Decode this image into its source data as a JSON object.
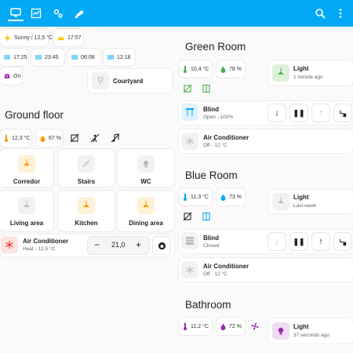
{
  "colors": {
    "header": "#03a9f4",
    "amber": "#ffc107",
    "orange": "#ff9800",
    "red": "#e53935",
    "purple": "#9c27b0",
    "green": "#4caf50",
    "blue": "#03a9f4"
  },
  "header": {
    "tabs": [
      "monitor-icon",
      "chart-icon",
      "settings-icon",
      "camera-icon"
    ],
    "actions": [
      "search-icon",
      "dots-menu-icon"
    ]
  },
  "left": {
    "weather": "Sunny / 12,5 °C",
    "clock": "17:57",
    "schedule": [
      "17:25",
      "23:45",
      "06:08",
      "12:18"
    ],
    "alarm_state": "On",
    "courtyard": "Courtyard",
    "ground_floor": {
      "title": "Ground floor",
      "temperature": "12,3 °C",
      "humidity": "67 %",
      "rooms": [
        "Corredor",
        "Stairs",
        "WC",
        "Living area",
        "Kitchen",
        "Dining area"
      ],
      "ac": {
        "name": "Air Conditioner",
        "status": "Heat - 12,5 °C",
        "setpoint": "21,0",
        "minus": "−",
        "plus": "+"
      }
    }
  },
  "green_room": {
    "title": "Green Room",
    "temperature": "10,4 °C",
    "humidity": "78 %",
    "light": {
      "name": "Light",
      "status": "1 minute ago"
    },
    "blind": {
      "name": "Blind",
      "status": "Open - 100%"
    },
    "ac": {
      "name": "Air Conditioner",
      "status": "Off - 12 °C"
    }
  },
  "blue_room": {
    "title": "Blue Room",
    "temperature": "11,3 °C",
    "humidity": "73 %",
    "light": {
      "name": "Light",
      "status": "Last week"
    },
    "blind": {
      "name": "Blind",
      "status": "Closed"
    },
    "ac": {
      "name": "Air Conditioner",
      "status": "Off - 12 °C"
    }
  },
  "bathroom": {
    "title": "Bathroom",
    "temperature": "11,2 °C",
    "humidity": "72 %",
    "light": {
      "name": "Light",
      "status": "37 seconds ago"
    }
  }
}
